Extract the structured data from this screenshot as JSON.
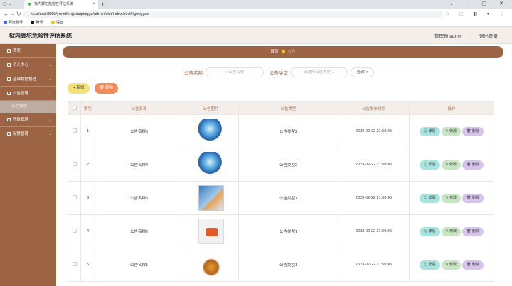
{
  "browser": {
    "tab_title": "狱内罪犯危险性评估系统",
    "new_tab": "+",
    "url": "localhost:8080/yuneifengxianpinggu/admin/dist/index.html#/gonggao",
    "bookmarks": [
      {
        "label": "百度翻译",
        "color": "#2b6de3"
      },
      {
        "label": "腾讯",
        "color": "#111111"
      },
      {
        "label": "语音",
        "color": "#f1c232"
      }
    ]
  },
  "header": {
    "title": "狱内罪犯危险性评估系统",
    "user": "管理员 admin",
    "logout": "退出登录"
  },
  "sidebar": {
    "items": [
      {
        "label": "首页",
        "arrow": ""
      },
      {
        "label": "个人中心",
        "arrow": "⌄"
      },
      {
        "label": "基础数据管理",
        "arrow": "⌄"
      },
      {
        "label": "公告管理",
        "arrow": "⌃"
      },
      {
        "label": "罚款管理",
        "arrow": "⌄"
      },
      {
        "label": "狱警管理",
        "arrow": "⌄"
      }
    ],
    "sub_item": "公告管理"
  },
  "breadcrumb": {
    "home": "首页",
    "current": "公告"
  },
  "search": {
    "name_label": "公告名称",
    "name_placeholder": "公告名称",
    "type_label": "公告类型",
    "type_placeholder": "请选择公告类型",
    "button": "查询"
  },
  "actions": {
    "add": "新增",
    "delete": "删除"
  },
  "colors": {
    "brand": "#9c6445",
    "add_btn": "#f3e07a",
    "del_btn": "#f28a5b"
  },
  "table": {
    "headers": [
      "索引",
      "公告名称",
      "公告图片",
      "公告类型",
      "公告发布时间",
      "操作"
    ],
    "op_labels": {
      "detail": "详情",
      "edit": "修改",
      "delete": "删除"
    },
    "rows": [
      {
        "index": "1",
        "name": "公告名称5",
        "type": "公告类型2",
        "time": "2023-02-22 21:50:45",
        "image": "globe"
      },
      {
        "index": "2",
        "name": "公告名称4",
        "type": "公告类型2",
        "time": "2023-02-22 21:50:45",
        "image": "globe"
      },
      {
        "index": "3",
        "name": "公告名称3",
        "type": "公告类型1",
        "time": "2023-02-22 21:50:45",
        "image": "hand-screen"
      },
      {
        "index": "4",
        "name": "公告名称2",
        "type": "公告类型1",
        "time": "2023-02-22 21:50:45",
        "image": "paper-icon"
      },
      {
        "index": "5",
        "name": "公告名称1",
        "type": "公告类型1",
        "time": "2023-02-22 21:50:45",
        "image": "news-text"
      }
    ]
  }
}
